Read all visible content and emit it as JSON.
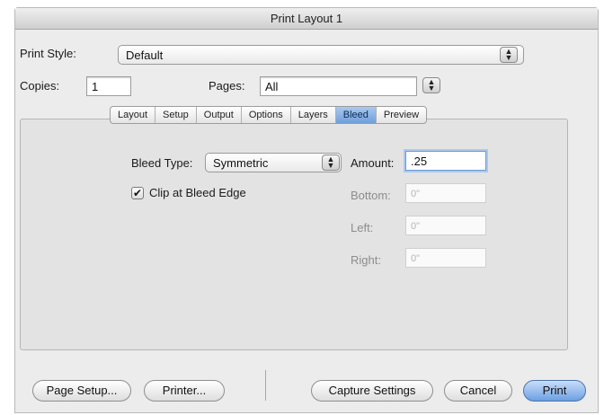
{
  "window": {
    "title": "Print Layout 1"
  },
  "print_style": {
    "label": "Print Style:",
    "value": "Default"
  },
  "copies": {
    "label": "Copies:",
    "value": "1"
  },
  "pages": {
    "label": "Pages:",
    "value": "All"
  },
  "tabs": [
    {
      "label": "Layout",
      "selected": false
    },
    {
      "label": "Setup",
      "selected": false
    },
    {
      "label": "Output",
      "selected": false
    },
    {
      "label": "Options",
      "selected": false
    },
    {
      "label": "Layers",
      "selected": false
    },
    {
      "label": "Bleed",
      "selected": true
    },
    {
      "label": "Preview",
      "selected": false
    }
  ],
  "bleed": {
    "type_label": "Bleed Type:",
    "type_value": "Symmetric",
    "clip_label": "Clip at Bleed Edge",
    "clip_checked": true,
    "amount_label": "Amount:",
    "amount_value": ".25",
    "bottom_label": "Bottom:",
    "bottom_value": "0\"",
    "left_label": "Left:",
    "left_value": "0\"",
    "right_label": "Right:",
    "right_value": "0\""
  },
  "buttons": {
    "page_setup": "Page Setup...",
    "printer": "Printer...",
    "capture": "Capture Settings",
    "cancel": "Cancel",
    "print": "Print"
  }
}
